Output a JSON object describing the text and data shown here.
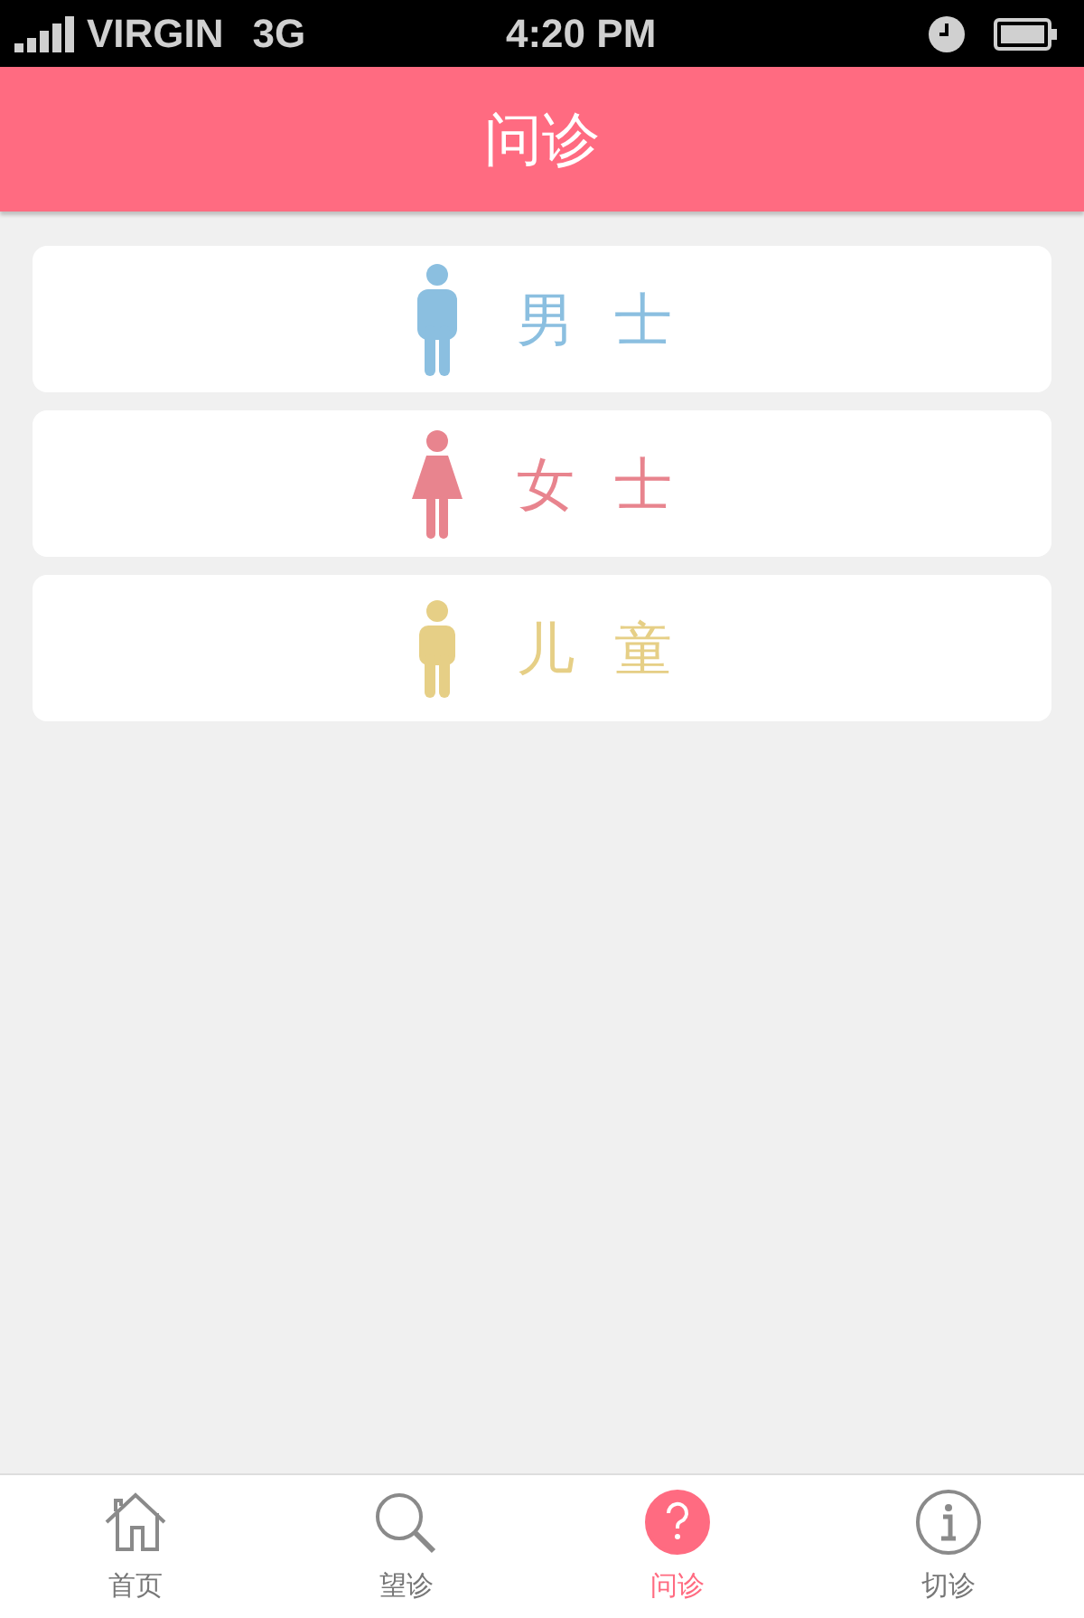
{
  "status_bar": {
    "carrier": "VIRGIN",
    "network": "3G",
    "time": "4:20 PM"
  },
  "header": {
    "title": "问诊"
  },
  "items": [
    {
      "kind": "man",
      "label": "男 士",
      "color": "#8bbfe0"
    },
    {
      "kind": "woman",
      "label": "女 士",
      "color": "#e8848e"
    },
    {
      "kind": "child",
      "label": "儿 童",
      "color": "#e6cf86"
    }
  ],
  "tabs": [
    {
      "kind": "home",
      "label": "首页",
      "selected": false
    },
    {
      "kind": "search",
      "label": "望诊",
      "selected": false
    },
    {
      "kind": "help",
      "label": "问诊",
      "selected": true
    },
    {
      "kind": "info",
      "label": "切诊",
      "selected": false
    }
  ]
}
